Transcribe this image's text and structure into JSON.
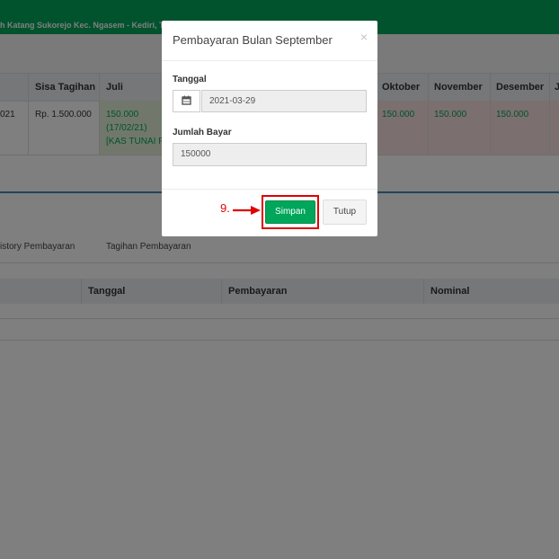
{
  "header": {
    "school_text": "h Katang Sukorejo Kec. Ngasem - Kediri, T"
  },
  "bill_table": {
    "columns": [
      "Sisa Tagihan",
      "Juli",
      "Oktober",
      "November",
      "Desember",
      "J"
    ],
    "row": {
      "year_fragment": "021",
      "sisa_tagihan": "Rp. 1.500.000",
      "juli_amount": "150.000",
      "juli_date": "(17/02/21)",
      "juli_note": "[KAS TUNAI P",
      "oktober": "150.000",
      "november": "150.000",
      "desember": "150.000"
    }
  },
  "tabs": [
    "istory Pembayaran",
    "Tagihan Pembayaran"
  ],
  "history_table": {
    "columns": [
      "Tanggal",
      "Pembayaran",
      "Nominal"
    ]
  },
  "modal": {
    "title": "Pembayaran Bulan September",
    "close_symbol": "×",
    "date_label": "Tanggal",
    "date_value": "2021-03-29",
    "amount_label": "Jumlah Bayar",
    "amount_value": "150000",
    "save_label": "Simpan",
    "close_label": "Tutup"
  },
  "annotation": {
    "step": "9."
  },
  "icons": {
    "date_addon": "calendar-icon"
  },
  "colors": {
    "primary_green": "#00a65a",
    "annotation_red": "#e00000",
    "overdue_pink": "#f7dede",
    "paid_green": "#e3f1d6"
  }
}
